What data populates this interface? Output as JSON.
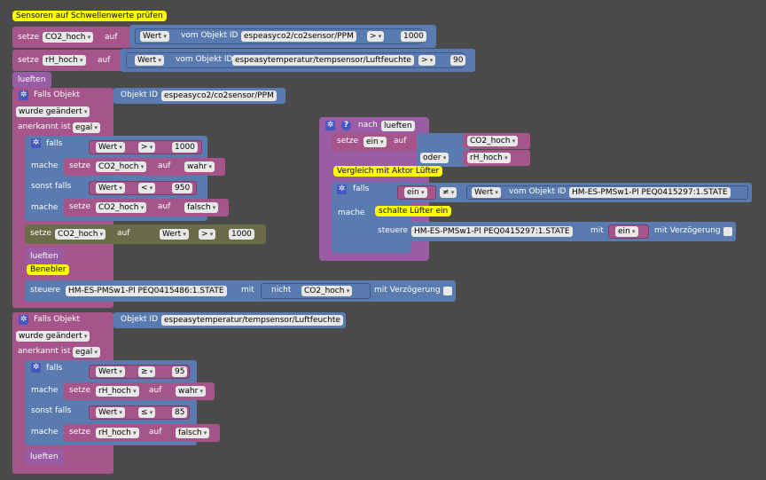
{
  "comments": {
    "sensor": "Sensoren auf Schwellenwerte prüfen",
    "compare": "Vergleich mit Aktor Lüfter",
    "fan_on": "schalte Lüfter ein",
    "fog": "Benebler"
  },
  "kw": {
    "setze": "setze",
    "auf": "auf",
    "wert": "Wert",
    "vom_objekt": "vom Objekt ID",
    "falls_objekt": "Falls Objekt",
    "objekt_id": "Objekt ID",
    "wurde": "wurde geändert",
    "anerkannt": "anerkannt ist",
    "egal": "egal",
    "falls": "falls",
    "mache": "mache",
    "sonst_falls": "sonst falls",
    "steuere": "steuere",
    "mit": "mit",
    "mit_verz": "mit Verzögerung",
    "nicht": "nicht",
    "nach": "nach",
    "oder": "oder",
    "lueften": "lueften",
    "ein": "ein",
    "wahr": "wahr",
    "falsch": "falsch"
  },
  "vars": {
    "co2": "CO2_hoch",
    "rh": "rH_hoch"
  },
  "ops": {
    "gt": ">",
    "lt": "<",
    "ge": "≥",
    "le": "≤",
    "ne": "≠"
  },
  "values": {
    "co2_thr": "1000",
    "rh_thr": "90",
    "co2_hi": "1000",
    "co2_lo": "950",
    "rh_hi": "95",
    "rh_lo": "85"
  },
  "objects": {
    "co2": "espeasyco2/co2sensor/PPM",
    "rh": "espeasytemperatur/tempsensor/Luftfeuchte",
    "fan": "HM-ES-PMSw1-Pl PEQ0415297:1.STATE",
    "fog": "HM-ES-PMSw1-Pl PEQ0415486:1.STATE"
  }
}
